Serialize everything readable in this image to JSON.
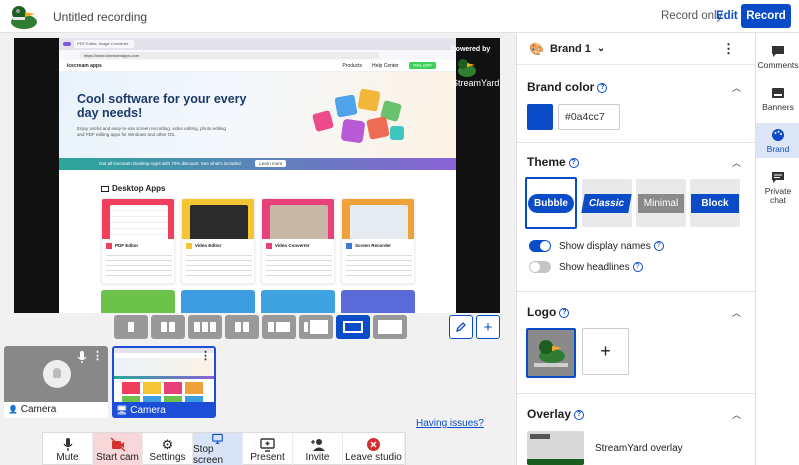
{
  "header": {
    "title": "Untitled recording",
    "record_only": "Record only",
    "edit": "Edit",
    "record": "Record"
  },
  "screen": {
    "tab_title": "PDF Editor, Image Converter",
    "url": "https://www.icecreamapps.com",
    "site_brand": "icecream apps",
    "nav_products": "Products",
    "nav_help": "Help Center",
    "nav_cta": "70% OFF",
    "hero_title": "Cool software for your every day needs!",
    "hero_text": "Enjoy useful and easy-to-use screen recording, video editing, photo editing and PDF editing apps for Windows and other OS.",
    "promo": "Get all Icecream Desktop Apps with 70% discount. See what's included.",
    "promo_btn": "Learn more",
    "section": "Desktop Apps",
    "cards": [
      "PDF Editor",
      "Video Editor",
      "Video Converter",
      "Screen Recorder"
    ],
    "powered_by": "Powered by",
    "streamyard": "StreamYard"
  },
  "tiles": {
    "camera": "Camera",
    "screen": "Camera"
  },
  "toolbar": {
    "mute": "Mute",
    "start_cam": "Start cam",
    "settings": "Settings",
    "stop_screen": "Stop screen",
    "present": "Present",
    "invite": "Invite",
    "leave": "Leave studio",
    "issues": "Having issues?"
  },
  "panel": {
    "brand": "Brand 1",
    "brand_color_title": "Brand color",
    "brand_color_value": "#0a4cc7",
    "theme_title": "Theme",
    "themes": [
      "Bubble",
      "Classic",
      "Minimal",
      "Block"
    ],
    "show_display_names": "Show display names",
    "show_headlines": "Show headlines",
    "logo_title": "Logo",
    "overlay_title": "Overlay",
    "overlay_label": "StreamYard overlay"
  },
  "rail": {
    "comments": "Comments",
    "banners": "Banners",
    "brand": "Brand",
    "private_chat": "Private chat"
  },
  "colors": {
    "accent": "#0a4cc7",
    "start_cam_bg": "#f7d7d7",
    "stop_screen_bg": "#d8e3f5"
  }
}
